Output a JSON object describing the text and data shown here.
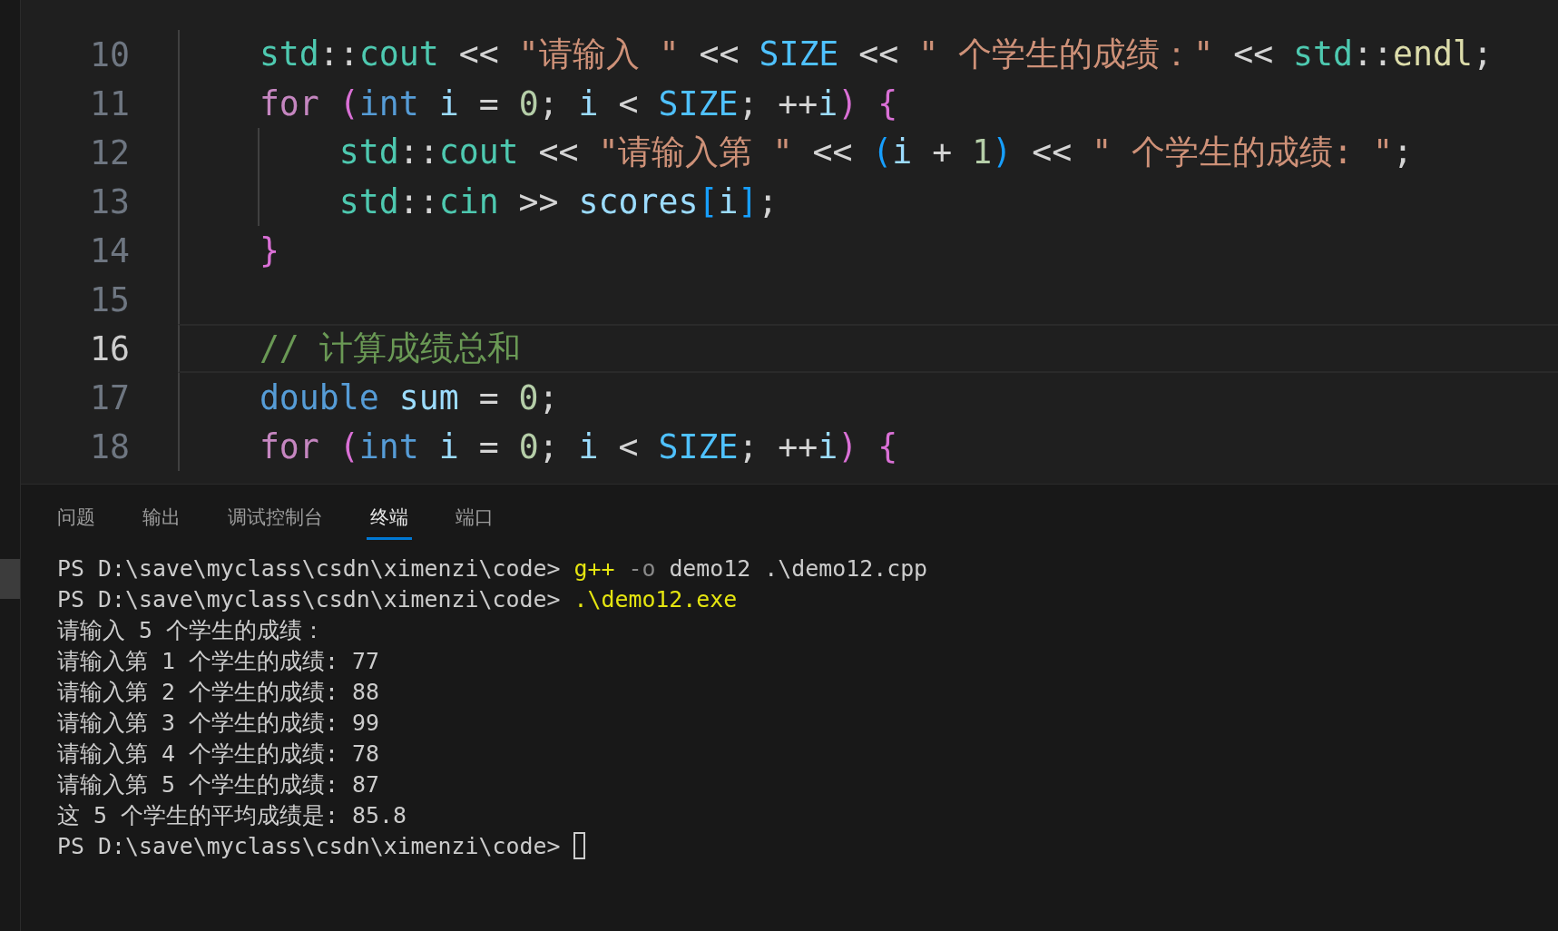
{
  "editor": {
    "lines": [
      {
        "number": "10",
        "current": false,
        "indent_guide": false,
        "tokens": [
          {
            "text": "    std",
            "kind": "ns"
          },
          {
            "text": "::",
            "kind": "plain"
          },
          {
            "text": "cout",
            "kind": "ns"
          },
          {
            "text": " << ",
            "kind": "plain"
          },
          {
            "text": "\"请输入 \"",
            "kind": "string"
          },
          {
            "text": " << ",
            "kind": "plain"
          },
          {
            "text": "SIZE",
            "kind": "const"
          },
          {
            "text": " << ",
            "kind": "plain"
          },
          {
            "text": "\" 个学生的成绩：\"",
            "kind": "string"
          },
          {
            "text": " << ",
            "kind": "plain"
          },
          {
            "text": "std",
            "kind": "ns"
          },
          {
            "text": "::",
            "kind": "plain"
          },
          {
            "text": "endl",
            "kind": "func"
          },
          {
            "text": ";",
            "kind": "plain"
          }
        ]
      },
      {
        "number": "11",
        "current": false,
        "indent_guide": false,
        "tokens": [
          {
            "text": "    for ",
            "kind": "keyword"
          },
          {
            "text": "(",
            "kind": "bracket2"
          },
          {
            "text": "int ",
            "kind": "type"
          },
          {
            "text": "i",
            "kind": "var"
          },
          {
            "text": " = ",
            "kind": "plain"
          },
          {
            "text": "0",
            "kind": "number"
          },
          {
            "text": "; ",
            "kind": "plain"
          },
          {
            "text": "i",
            "kind": "var"
          },
          {
            "text": " < ",
            "kind": "plain"
          },
          {
            "text": "SIZE",
            "kind": "const"
          },
          {
            "text": "; ++",
            "kind": "plain"
          },
          {
            "text": "i",
            "kind": "var"
          },
          {
            "text": ")",
            "kind": "bracket2"
          },
          {
            "text": " {",
            "kind": "bracket2"
          }
        ]
      },
      {
        "number": "12",
        "current": false,
        "indent_guide": true,
        "tokens": [
          {
            "text": "        std",
            "kind": "ns"
          },
          {
            "text": "::",
            "kind": "plain"
          },
          {
            "text": "cout",
            "kind": "ns"
          },
          {
            "text": " << ",
            "kind": "plain"
          },
          {
            "text": "\"请输入第 \"",
            "kind": "string"
          },
          {
            "text": " << ",
            "kind": "plain"
          },
          {
            "text": "(",
            "kind": "bracket3"
          },
          {
            "text": "i",
            "kind": "var"
          },
          {
            "text": " + ",
            "kind": "plain"
          },
          {
            "text": "1",
            "kind": "number"
          },
          {
            "text": ")",
            "kind": "bracket3"
          },
          {
            "text": " << ",
            "kind": "plain"
          },
          {
            "text": "\" 个学生的成绩: \"",
            "kind": "string"
          },
          {
            "text": ";",
            "kind": "plain"
          }
        ]
      },
      {
        "number": "13",
        "current": false,
        "indent_guide": true,
        "tokens": [
          {
            "text": "        std",
            "kind": "ns"
          },
          {
            "text": "::",
            "kind": "plain"
          },
          {
            "text": "cin",
            "kind": "ns"
          },
          {
            "text": " >> ",
            "kind": "plain"
          },
          {
            "text": "scores",
            "kind": "var"
          },
          {
            "text": "[",
            "kind": "bracket3"
          },
          {
            "text": "i",
            "kind": "var"
          },
          {
            "text": "]",
            "kind": "bracket3"
          },
          {
            "text": ";",
            "kind": "plain"
          }
        ]
      },
      {
        "number": "14",
        "current": false,
        "indent_guide": false,
        "tokens": [
          {
            "text": "    }",
            "kind": "bracket2"
          }
        ]
      },
      {
        "number": "15",
        "current": false,
        "indent_guide": false
      },
      {
        "number": "16",
        "current": true,
        "indent_guide": false,
        "tokens": [
          {
            "text": "    // 计算成绩总和",
            "kind": "comment"
          }
        ]
      },
      {
        "number": "17",
        "current": false,
        "indent_guide": false,
        "tokens": [
          {
            "text": "    double ",
            "kind": "type"
          },
          {
            "text": "sum",
            "kind": "var"
          },
          {
            "text": " = ",
            "kind": "plain"
          },
          {
            "text": "0",
            "kind": "number"
          },
          {
            "text": ";",
            "kind": "plain"
          }
        ]
      },
      {
        "number": "18",
        "current": false,
        "indent_guide": false,
        "tokens": [
          {
            "text": "    for ",
            "kind": "keyword"
          },
          {
            "text": "(",
            "kind": "bracket2"
          },
          {
            "text": "int ",
            "kind": "type"
          },
          {
            "text": "i",
            "kind": "var"
          },
          {
            "text": " = ",
            "kind": "plain"
          },
          {
            "text": "0",
            "kind": "number"
          },
          {
            "text": "; ",
            "kind": "plain"
          },
          {
            "text": "i",
            "kind": "var"
          },
          {
            "text": " < ",
            "kind": "plain"
          },
          {
            "text": "SIZE",
            "kind": "const"
          },
          {
            "text": "; ++",
            "kind": "plain"
          },
          {
            "text": "i",
            "kind": "var"
          },
          {
            "text": ")",
            "kind": "bracket2"
          },
          {
            "text": " {",
            "kind": "bracket2"
          }
        ]
      }
    ]
  },
  "panel": {
    "tabs": [
      {
        "label": "问题",
        "selected": false
      },
      {
        "label": "输出",
        "selected": false
      },
      {
        "label": "调试控制台",
        "selected": false
      },
      {
        "label": "终端",
        "selected": true
      },
      {
        "label": "端口",
        "selected": false
      }
    ],
    "terminal": {
      "lines": [
        {
          "tokens": [
            {
              "text": "PS D:\\save\\myclass\\csdn\\ximenzi\\code> ",
              "kind": "plain"
            },
            {
              "text": "g++",
              "kind": "command"
            },
            {
              "text": " -o",
              "kind": "flag"
            },
            {
              "text": " demo12 .\\demo12.cpp",
              "kind": "plain"
            }
          ]
        },
        {
          "tokens": [
            {
              "text": "PS D:\\save\\myclass\\csdn\\ximenzi\\code> ",
              "kind": "plain"
            },
            {
              "text": ".\\demo12.exe",
              "kind": "command"
            }
          ]
        },
        {
          "tokens": [
            {
              "text": "请输入 5 个学生的成绩：",
              "kind": "plain"
            }
          ]
        },
        {
          "tokens": [
            {
              "text": "请输入第 1 个学生的成绩: 77",
              "kind": "plain"
            }
          ]
        },
        {
          "tokens": [
            {
              "text": "请输入第 2 个学生的成绩: 88",
              "kind": "plain"
            }
          ]
        },
        {
          "tokens": [
            {
              "text": "请输入第 3 个学生的成绩: 99",
              "kind": "plain"
            }
          ]
        },
        {
          "tokens": [
            {
              "text": "请输入第 4 个学生的成绩: 78",
              "kind": "plain"
            }
          ]
        },
        {
          "tokens": [
            {
              "text": "请输入第 5 个学生的成绩: 87",
              "kind": "plain"
            }
          ]
        },
        {
          "tokens": [
            {
              "text": "这 5 个学生的平均成绩是: 85.8",
              "kind": "plain"
            }
          ]
        },
        {
          "tokens": [
            {
              "text": "PS D:\\save\\myclass\\csdn\\ximenzi\\code> ",
              "kind": "plain"
            }
          ],
          "cursor": true
        }
      ]
    }
  }
}
